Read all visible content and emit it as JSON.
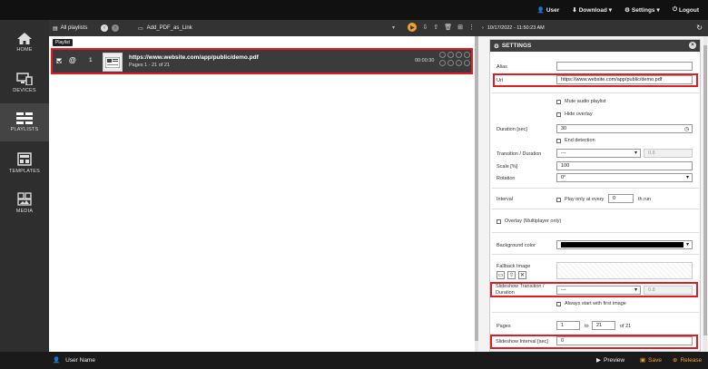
{
  "topbar": {
    "user": "User",
    "download": "Download",
    "settings": "Settings",
    "logout": "Logout"
  },
  "sidebar": {
    "items": [
      {
        "label": "HOME"
      },
      {
        "label": "DEVICES"
      },
      {
        "label": "PLAYLISTS"
      },
      {
        "label": "TEMPLATES"
      },
      {
        "label": "MEDIA"
      }
    ]
  },
  "playlist_toolbar": {
    "all_playlists": "All playlists",
    "playlist_name": "Add_PDF_as_Link"
  },
  "playlist": {
    "tooltip": "Playlist",
    "row": {
      "index": "1",
      "url": "https://www.website.com/app/public/demo.pdf",
      "pages": "Pages 1 - 21 of 21",
      "duration": "00:00:30"
    }
  },
  "right_header": {
    "datetime": "10/17/2022 - 11:50:23 AM"
  },
  "settings": {
    "title": "SETTINGS",
    "alias_label": "Alias",
    "alias_value": "",
    "url_label": "Url",
    "url_value": "https://www.website.com/app/public/demo.pdf",
    "mute_audio": "Mute audio playlist",
    "hide_overlay": "Hide overlay",
    "duration_label": "Duration [sec]",
    "duration_value": "30",
    "end_detection": "End detection",
    "transition_label": "Transition / Duration",
    "transition_value": "---",
    "transition_duration": "0.8",
    "scale_label": "Scale [%]",
    "scale_value": "100",
    "rotation_label": "Rotation",
    "rotation_value": "0°",
    "interval_label": "Interval",
    "play_only_every": "Play only at every",
    "interval_value": "0",
    "th_run": "th run",
    "overlay_multiplayer": "Overlay (Multiplayer only)",
    "background_color_label": "Background color",
    "fallback_image_label": "Fallback Image",
    "slideshow_transition_label": "Slideshow Transition / Duration",
    "slideshow_transition_value": "---",
    "slideshow_transition_duration": "0.8",
    "always_start_first": "Always start with first image",
    "pages_label": "Pages",
    "pages_from": "1",
    "pages_to_word": "to",
    "pages_to": "21",
    "pages_of": "of 21",
    "slideshow_interval_label": "Slideshow Interval [sec]",
    "slideshow_interval_value": "0"
  },
  "bottombar": {
    "user_name": "User Name",
    "preview": "Preview",
    "save": "Save",
    "release": "Release"
  },
  "colors": {
    "highlight": "#e31b23",
    "accent": "#f0a030"
  }
}
